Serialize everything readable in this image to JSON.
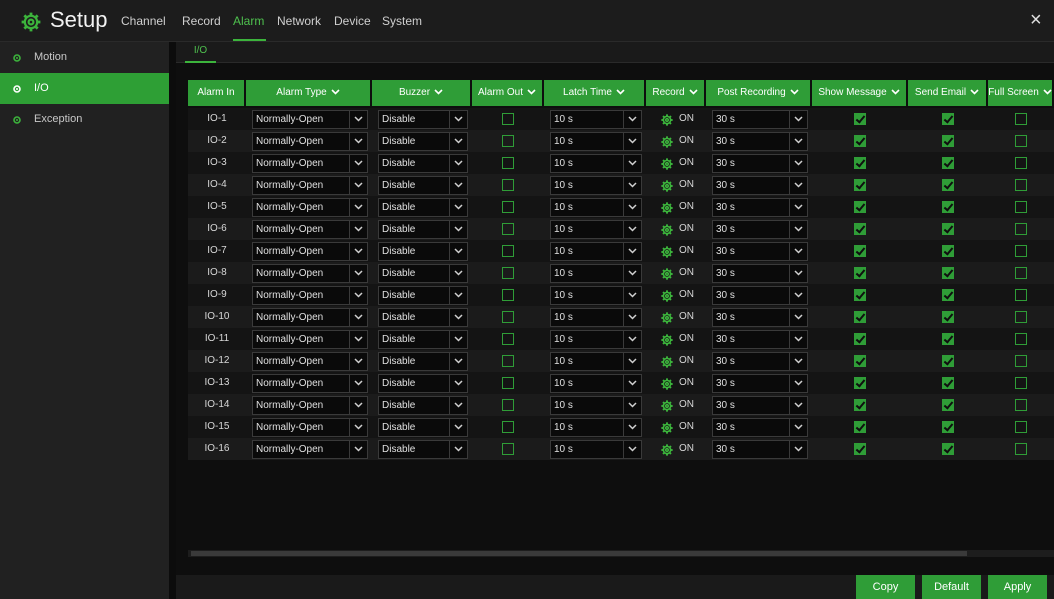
{
  "app": {
    "title": "Setup",
    "icon": "gear-icon",
    "accent": "#2f9d37"
  },
  "nav": {
    "channel": "Channel",
    "record": "Record",
    "alarm": "Alarm",
    "network": "Network",
    "device": "Device",
    "system": "System",
    "active": "Alarm",
    "close": "×"
  },
  "sidebar": {
    "items": [
      {
        "label": "Motion"
      },
      {
        "label": "I/O",
        "active": true
      },
      {
        "label": "Exception"
      }
    ]
  },
  "subtab": {
    "label": "I/O"
  },
  "table": {
    "headers": [
      "Alarm In",
      "Alarm Type",
      "Buzzer",
      "Alarm Out",
      "Latch Time",
      "Record",
      "Post Recording",
      "Show Message",
      "Send Email",
      "Full Screen"
    ],
    "rows": [
      {
        "alarm_in": "IO-1",
        "alarm_type": "Normally-Open",
        "buzzer": "Disable",
        "alarm_out": false,
        "latch_time": "10 s",
        "record": "ON",
        "post_recording": "30 s",
        "show_message": true,
        "send_email": true,
        "full_screen": false
      },
      {
        "alarm_in": "IO-2",
        "alarm_type": "Normally-Open",
        "buzzer": "Disable",
        "alarm_out": false,
        "latch_time": "10 s",
        "record": "ON",
        "post_recording": "30 s",
        "show_message": true,
        "send_email": true,
        "full_screen": false
      },
      {
        "alarm_in": "IO-3",
        "alarm_type": "Normally-Open",
        "buzzer": "Disable",
        "alarm_out": false,
        "latch_time": "10 s",
        "record": "ON",
        "post_recording": "30 s",
        "show_message": true,
        "send_email": true,
        "full_screen": false
      },
      {
        "alarm_in": "IO-4",
        "alarm_type": "Normally-Open",
        "buzzer": "Disable",
        "alarm_out": false,
        "latch_time": "10 s",
        "record": "ON",
        "post_recording": "30 s",
        "show_message": true,
        "send_email": true,
        "full_screen": false
      },
      {
        "alarm_in": "IO-5",
        "alarm_type": "Normally-Open",
        "buzzer": "Disable",
        "alarm_out": false,
        "latch_time": "10 s",
        "record": "ON",
        "post_recording": "30 s",
        "show_message": true,
        "send_email": true,
        "full_screen": false
      },
      {
        "alarm_in": "IO-6",
        "alarm_type": "Normally-Open",
        "buzzer": "Disable",
        "alarm_out": false,
        "latch_time": "10 s",
        "record": "ON",
        "post_recording": "30 s",
        "show_message": true,
        "send_email": true,
        "full_screen": false
      },
      {
        "alarm_in": "IO-7",
        "alarm_type": "Normally-Open",
        "buzzer": "Disable",
        "alarm_out": false,
        "latch_time": "10 s",
        "record": "ON",
        "post_recording": "30 s",
        "show_message": true,
        "send_email": true,
        "full_screen": false
      },
      {
        "alarm_in": "IO-8",
        "alarm_type": "Normally-Open",
        "buzzer": "Disable",
        "alarm_out": false,
        "latch_time": "10 s",
        "record": "ON",
        "post_recording": "30 s",
        "show_message": true,
        "send_email": true,
        "full_screen": false
      },
      {
        "alarm_in": "IO-9",
        "alarm_type": "Normally-Open",
        "buzzer": "Disable",
        "alarm_out": false,
        "latch_time": "10 s",
        "record": "ON",
        "post_recording": "30 s",
        "show_message": true,
        "send_email": true,
        "full_screen": false
      },
      {
        "alarm_in": "IO-10",
        "alarm_type": "Normally-Open",
        "buzzer": "Disable",
        "alarm_out": false,
        "latch_time": "10 s",
        "record": "ON",
        "post_recording": "30 s",
        "show_message": true,
        "send_email": true,
        "full_screen": false
      },
      {
        "alarm_in": "IO-11",
        "alarm_type": "Normally-Open",
        "buzzer": "Disable",
        "alarm_out": false,
        "latch_time": "10 s",
        "record": "ON",
        "post_recording": "30 s",
        "show_message": true,
        "send_email": true,
        "full_screen": false
      },
      {
        "alarm_in": "IO-12",
        "alarm_type": "Normally-Open",
        "buzzer": "Disable",
        "alarm_out": false,
        "latch_time": "10 s",
        "record": "ON",
        "post_recording": "30 s",
        "show_message": true,
        "send_email": true,
        "full_screen": false
      },
      {
        "alarm_in": "IO-13",
        "alarm_type": "Normally-Open",
        "buzzer": "Disable",
        "alarm_out": false,
        "latch_time": "10 s",
        "record": "ON",
        "post_recording": "30 s",
        "show_message": true,
        "send_email": true,
        "full_screen": false
      },
      {
        "alarm_in": "IO-14",
        "alarm_type": "Normally-Open",
        "buzzer": "Disable",
        "alarm_out": false,
        "latch_time": "10 s",
        "record": "ON",
        "post_recording": "30 s",
        "show_message": true,
        "send_email": true,
        "full_screen": false
      },
      {
        "alarm_in": "IO-15",
        "alarm_type": "Normally-Open",
        "buzzer": "Disable",
        "alarm_out": false,
        "latch_time": "10 s",
        "record": "ON",
        "post_recording": "30 s",
        "show_message": true,
        "send_email": true,
        "full_screen": false
      },
      {
        "alarm_in": "IO-16",
        "alarm_type": "Normally-Open",
        "buzzer": "Disable",
        "alarm_out": false,
        "latch_time": "10 s",
        "record": "ON",
        "post_recording": "30 s",
        "show_message": true,
        "send_email": true,
        "full_screen": false
      }
    ]
  },
  "footer": {
    "copy": "Copy",
    "default": "Default",
    "apply": "Apply"
  }
}
